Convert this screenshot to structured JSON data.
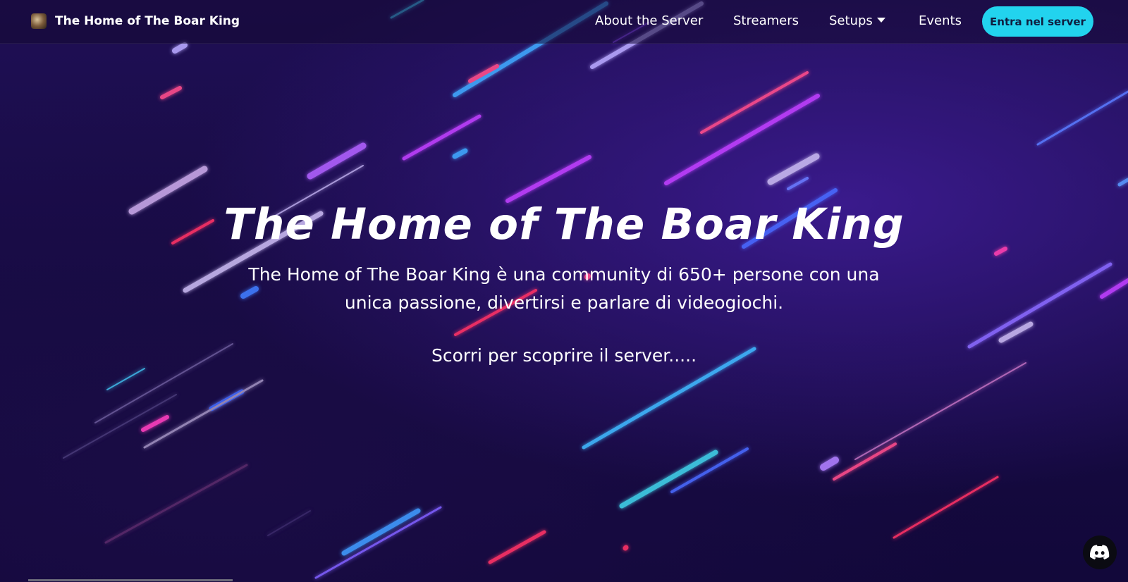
{
  "navbar": {
    "brand_name": "The Home of The Boar King",
    "links": [
      {
        "label": "About the Server"
      },
      {
        "label": "Streamers"
      },
      {
        "label": "Setups"
      },
      {
        "label": "Events"
      }
    ],
    "cta_label": "Entra nel server",
    "cta_color": "#22d3ee"
  },
  "hero": {
    "title": "The Home of The Boar King",
    "description": "The Home of The Boar King è una community di 650+ persone con una unica passione, divertirsi e parlare di videogiochi.",
    "scroll_hint": "Scorri per scoprire il server....."
  },
  "icons": {
    "brand_logo": "boar-logo-icon",
    "setups_caret": "chevron-down-icon",
    "discord": "discord-icon"
  }
}
